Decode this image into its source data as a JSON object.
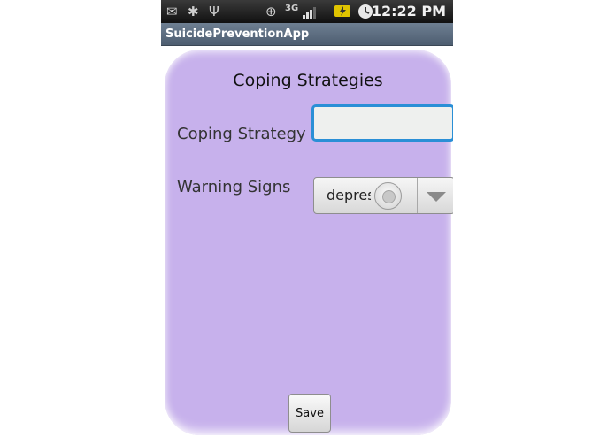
{
  "status_bar": {
    "time": "12:22 PM",
    "network_label": "3G",
    "icons": [
      "mail-icon",
      "bug-icon",
      "usb-icon",
      "gps-icon",
      "signal-icon",
      "battery-icon",
      "alarm-clock-icon"
    ]
  },
  "app": {
    "title": "SuicidePreventionApp"
  },
  "form": {
    "heading": "Coping Strategies",
    "coping_label": "Coping Strategy",
    "coping_value": "",
    "warning_label": "Warning Signs",
    "warning_selected": "depres",
    "save_label": "Save"
  },
  "colors": {
    "card_background": "#c7b1ec",
    "input_focus_border": "#2a8fd6",
    "title_bar": "#5d6d80"
  }
}
